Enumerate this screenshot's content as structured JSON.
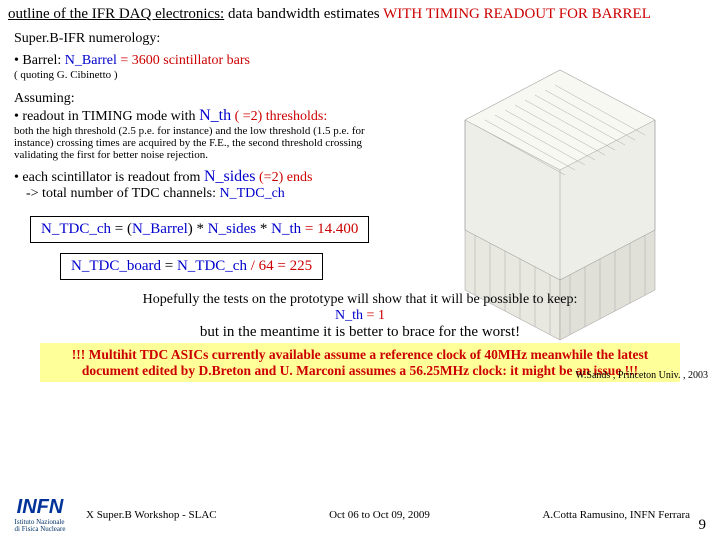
{
  "title": {
    "prefix": "outline of the IFR DAQ electronics:",
    "mid": " data bandwidth estimates ",
    "suffix": "WITH TIMING READOUT FOR BARREL"
  },
  "numerology": "Super.B-IFR numerology:",
  "barrel": {
    "label": "• Barrel:   ",
    "nbarrel": "N_Barrel",
    "eq": "   = 3600 scintillator bars"
  },
  "quote": "( quoting G. Cibinetto )",
  "assume": "Assuming:",
  "timing": {
    "pre": "• readout in TIMING mode with ",
    "nth": "N_th",
    "post": " ( =2) thresholds:"
  },
  "small1": "both the high threshold (2.5 p.e. for instance) and the low threshold (1.5 p.e. for instance) crossing times are acquired by the F.E., the second threshold crossing validating the first for better noise rejection.",
  "scint": {
    "pre": "• each scintillator is readout from ",
    "nsides": "N_sides",
    "post": " (=2) ends"
  },
  "tdcline": {
    "pre": "-> total number of TDC channels: ",
    "ntdc": "N_TDC_ch"
  },
  "formula1": {
    "a": "N_TDC_ch",
    "b": " = (",
    "c": "N_Barrel",
    "d": ") * ",
    "e": "N_sides",
    "f": " * ",
    "g": "N_th",
    "h": " = 14.400"
  },
  "formula2": {
    "a": "N_TDC_board",
    "b": " = ",
    "c": "N_TDC_ch",
    "d": " / 64 = 225"
  },
  "credit": "W.Sands , Princeton Univ. , 2003",
  "hopefully": {
    "pre": "Hopefully the tests on the prototype will show that it will be possible to keep: ",
    "nth": "N_th",
    "eq": " = 1"
  },
  "butline": "but in the meantime it is better to brace for the worst!",
  "warnbox": "!!! Multihit TDC ASICs currently available assume a reference clock of 40MHz meanwhile the latest document edited by D.Breton and U. Marconi assumes a 56.25MHz clock: it might be an issue !!!",
  "footer": {
    "workshop": "X Super.B Workshop - SLAC",
    "dates": "Oct 06 to Oct 09, 2009",
    "author": "A.Cotta Ramusino, INFN Ferrara",
    "page": "9",
    "logo": "INFN",
    "logosub": "Istituto Nazionale\ndi Fisica Nucleare"
  }
}
